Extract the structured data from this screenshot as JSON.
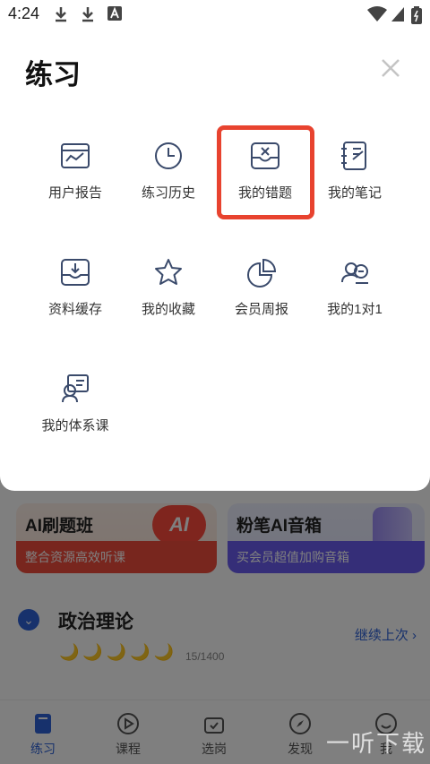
{
  "status_bar": {
    "time": "4:24",
    "icons": [
      "download-icon",
      "download-icon",
      "font-icon",
      "wifi-icon",
      "signal-icon",
      "battery-icon"
    ]
  },
  "sheet": {
    "title": "练习",
    "items": [
      {
        "label": "用户报告",
        "icon": "report-icon"
      },
      {
        "label": "练习历史",
        "icon": "clock-icon"
      },
      {
        "label": "我的错题",
        "icon": "wrong-questions-icon"
      },
      {
        "label": "我的笔记",
        "icon": "notes-icon"
      },
      {
        "label": "资料缓存",
        "icon": "download-tray-icon"
      },
      {
        "label": "我的收藏",
        "icon": "star-icon"
      },
      {
        "label": "会员周报",
        "icon": "pie-chart-icon"
      },
      {
        "label": "我的1对1",
        "icon": "tutor-icon"
      },
      {
        "label": "我的体系课",
        "icon": "course-icon"
      }
    ],
    "highlight_color": "#e8432f"
  },
  "background": {
    "promos": [
      {
        "title": "AI刷题班",
        "subtitle": "整合资源高效听课",
        "badge": "AI"
      },
      {
        "title": "粉笔AI音箱",
        "subtitle": "买会员超值加购音箱"
      }
    ],
    "subject": {
      "title": "政治理论",
      "continue_label": "继续上次",
      "progress": "15/1400"
    },
    "tabs": [
      {
        "label": "练习",
        "active": true
      },
      {
        "label": "课程"
      },
      {
        "label": "选岗"
      },
      {
        "label": "发现"
      },
      {
        "label": "我"
      }
    ]
  },
  "watermark": "一听下载",
  "colors": {
    "accent": "#2f63d8",
    "icon_stroke": "#3a4a6b",
    "highlight": "#e8432f"
  }
}
